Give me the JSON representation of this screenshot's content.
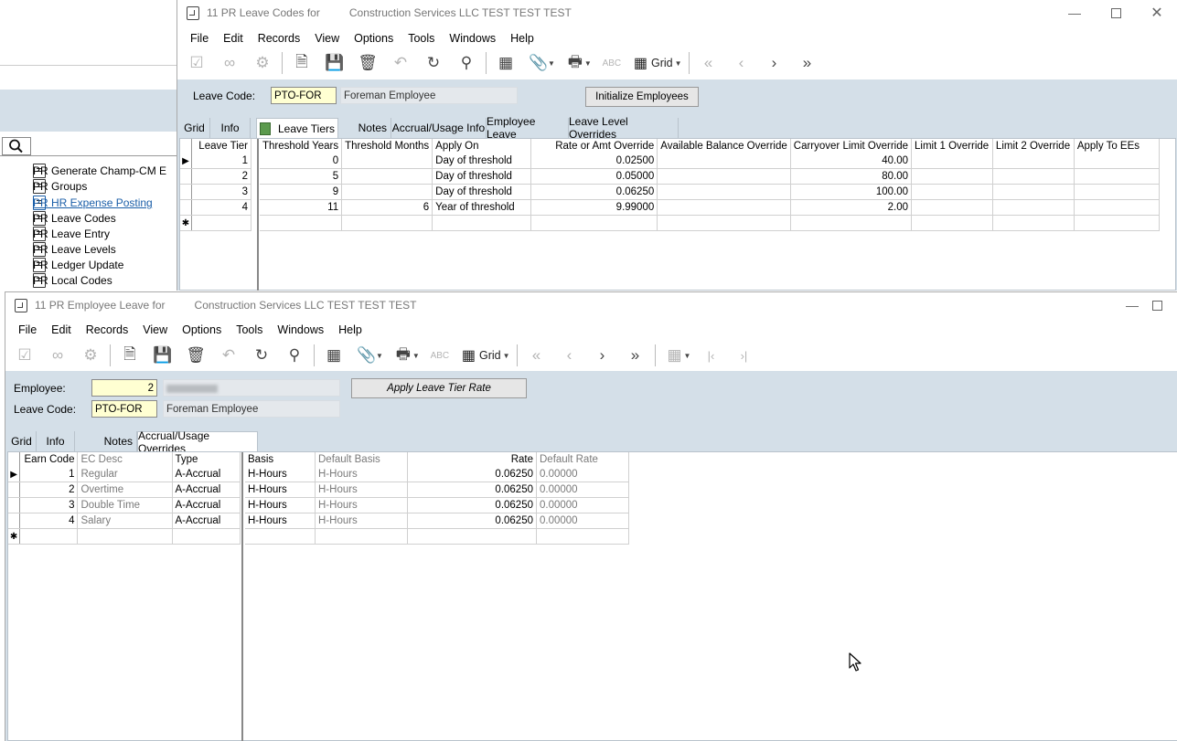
{
  "nav": {
    "items": [
      {
        "label": "PR Generate Champ-CM E",
        "link": false
      },
      {
        "label": "PR Groups",
        "link": false
      },
      {
        "label": "PR HR Expense Posting",
        "link": true
      },
      {
        "label": "PR Leave Codes",
        "link": false
      },
      {
        "label": "PR Leave Entry",
        "link": false
      },
      {
        "label": "PR Leave Levels",
        "link": false
      },
      {
        "label": "PR Ledger Update",
        "link": false
      },
      {
        "label": "PR Local Codes",
        "link": false
      }
    ]
  },
  "win1": {
    "title_left": "11 PR Leave Codes for",
    "title_right": "Construction Services LLC TEST TEST TEST",
    "menu": [
      "File",
      "Edit",
      "Records",
      "View",
      "Options",
      "Tools",
      "Windows",
      "Help"
    ],
    "grid_label": "Grid",
    "leave_code_label": "Leave Code:",
    "leave_code_value": "PTO-FOR",
    "leave_code_desc": "Foreman Employee",
    "init_button": "Initialize Employees",
    "tabs": [
      "Grid",
      "Info",
      "Leave Tiers",
      "Notes",
      "Accrual/Usage Info",
      "Employee Leave",
      "Leave Level Overrides"
    ],
    "tiers_table": {
      "left_header": "Leave Tier",
      "columns": [
        "Threshold Years",
        "Threshold Months",
        "Apply On",
        "Rate or Amt Override",
        "Available Balance Override",
        "Carryover Limit Override",
        "Limit 1 Override",
        "Limit 2 Override",
        "Apply To EEs"
      ],
      "rows": [
        {
          "tier": "1",
          "years": "0",
          "months": "",
          "apply_on": "Day of threshold",
          "rate": "0.02500",
          "avail": "",
          "carry": "40.00"
        },
        {
          "tier": "2",
          "years": "5",
          "months": "",
          "apply_on": "Day of threshold",
          "rate": "0.05000",
          "avail": "",
          "carry": "80.00"
        },
        {
          "tier": "3",
          "years": "9",
          "months": "",
          "apply_on": "Day of threshold",
          "rate": "0.06250",
          "avail": "",
          "carry": "100.00"
        },
        {
          "tier": "4",
          "years": "11",
          "months": "6",
          "apply_on": "Year of threshold",
          "rate": "9.99000",
          "avail": "",
          "carry": "2.00"
        }
      ]
    }
  },
  "win2": {
    "title_left": "11 PR Employee Leave for",
    "title_right": "Construction Services LLC TEST TEST TEST",
    "menu": [
      "File",
      "Edit",
      "Records",
      "View",
      "Options",
      "Tools",
      "Windows",
      "Help"
    ],
    "grid_label": "Grid",
    "employee_label": "Employee:",
    "employee_value": "2",
    "leave_code_label": "Leave Code:",
    "leave_code_value": "PTO-FOR",
    "leave_code_desc": "Foreman Employee",
    "apply_button": "Apply Leave Tier Rate",
    "tabs": [
      "Grid",
      "Info",
      "Notes",
      "Accrual/Usage Overrides"
    ],
    "earn_table": {
      "left_columns": [
        "Earn Code",
        "EC Desc",
        "Type"
      ],
      "right_columns": [
        "Basis",
        "Default Basis",
        "Rate",
        "Default Rate"
      ],
      "rows": [
        {
          "code": "1",
          "desc": "Regular",
          "type": "A-Accrual",
          "basis": "H-Hours",
          "default_basis": "H-Hours",
          "rate": "0.06250",
          "default_rate": "0.00000"
        },
        {
          "code": "2",
          "desc": "Overtime",
          "type": "A-Accrual",
          "basis": "H-Hours",
          "default_basis": "H-Hours",
          "rate": "0.06250",
          "default_rate": "0.00000"
        },
        {
          "code": "3",
          "desc": "Double Time",
          "type": "A-Accrual",
          "basis": "H-Hours",
          "default_basis": "H-Hours",
          "rate": "0.06250",
          "default_rate": "0.00000"
        },
        {
          "code": "4",
          "desc": "Salary",
          "type": "A-Accrual",
          "basis": "H-Hours",
          "default_basis": "H-Hours",
          "rate": "0.06250",
          "default_rate": "0.00000"
        }
      ]
    }
  }
}
